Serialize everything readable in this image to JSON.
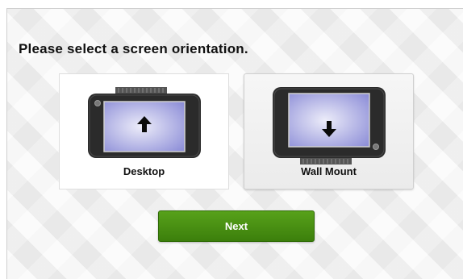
{
  "prompt": "Please select a screen orientation.",
  "options": [
    {
      "label": "Desktop",
      "icon": "arrow-up-icon",
      "selected": false
    },
    {
      "label": "Wall Mount",
      "icon": "arrow-down-icon",
      "selected": true
    }
  ],
  "next_label": "Next",
  "colors": {
    "accent_green": "#4a9213",
    "device_frame": "#2b2b2b",
    "screen_tint": "#a6a8e6"
  }
}
